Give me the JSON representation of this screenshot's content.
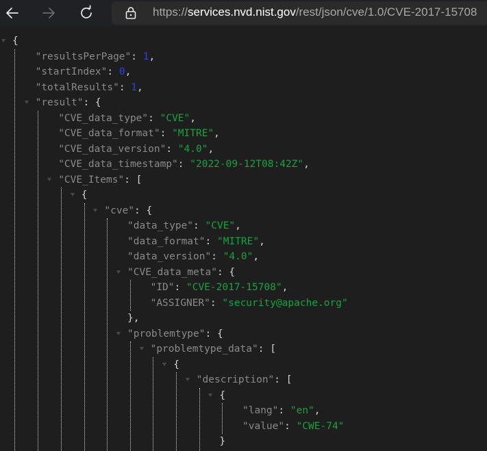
{
  "browser": {
    "url_scheme": "https://",
    "url_host": "services.nvd.nist.gov",
    "url_path": "/rest/json/cve/1.0/CVE-2017-15708"
  },
  "json_view": {
    "colors": {
      "key": "#8a8a8a",
      "punctuation": "#d4d4d4",
      "string": "#17a33e",
      "number": "#2d3ef5",
      "background": "#1e1e1e"
    },
    "lines": [
      {
        "parts": [
          {
            "t": "p",
            "v": "{"
          }
        ],
        "collapsible": true
      },
      {
        "parts": [
          {
            "t": "k",
            "v": "\"resultsPerPage\""
          },
          {
            "t": "p",
            "v": ": "
          },
          {
            "t": "n",
            "v": "1"
          },
          {
            "t": "p",
            "v": ","
          }
        ]
      },
      {
        "parts": [
          {
            "t": "k",
            "v": "\"startIndex\""
          },
          {
            "t": "p",
            "v": ": "
          },
          {
            "t": "n",
            "v": "0"
          },
          {
            "t": "p",
            "v": ","
          }
        ]
      },
      {
        "parts": [
          {
            "t": "k",
            "v": "\"totalResults\""
          },
          {
            "t": "p",
            "v": ": "
          },
          {
            "t": "n",
            "v": "1"
          },
          {
            "t": "p",
            "v": ","
          }
        ]
      },
      {
        "parts": [
          {
            "t": "k",
            "v": "\"result\""
          },
          {
            "t": "p",
            "v": ": {"
          }
        ],
        "collapsible": true
      },
      {
        "parts": [
          {
            "t": "k",
            "v": "\"CVE_data_type\""
          },
          {
            "t": "p",
            "v": ": "
          },
          {
            "t": "s",
            "v": "\"CVE\""
          },
          {
            "t": "p",
            "v": ","
          }
        ]
      },
      {
        "parts": [
          {
            "t": "k",
            "v": "\"CVE_data_format\""
          },
          {
            "t": "p",
            "v": ": "
          },
          {
            "t": "s",
            "v": "\"MITRE\""
          },
          {
            "t": "p",
            "v": ","
          }
        ]
      },
      {
        "parts": [
          {
            "t": "k",
            "v": "\"CVE_data_version\""
          },
          {
            "t": "p",
            "v": ": "
          },
          {
            "t": "s",
            "v": "\"4.0\""
          },
          {
            "t": "p",
            "v": ","
          }
        ]
      },
      {
        "parts": [
          {
            "t": "k",
            "v": "\"CVE_data_timestamp\""
          },
          {
            "t": "p",
            "v": ": "
          },
          {
            "t": "s",
            "v": "\"2022-09-12T08:42Z\""
          },
          {
            "t": "p",
            "v": ","
          }
        ]
      },
      {
        "parts": [
          {
            "t": "k",
            "v": "\"CVE_Items\""
          },
          {
            "t": "p",
            "v": ": ["
          }
        ],
        "collapsible": true
      },
      {
        "parts": [
          {
            "t": "p",
            "v": "{"
          }
        ],
        "collapsible": true
      },
      {
        "parts": [
          {
            "t": "k",
            "v": "\"cve\""
          },
          {
            "t": "p",
            "v": ": {"
          }
        ],
        "collapsible": true
      },
      {
        "parts": [
          {
            "t": "k",
            "v": "\"data_type\""
          },
          {
            "t": "p",
            "v": ": "
          },
          {
            "t": "s",
            "v": "\"CVE\""
          },
          {
            "t": "p",
            "v": ","
          }
        ]
      },
      {
        "parts": [
          {
            "t": "k",
            "v": "\"data_format\""
          },
          {
            "t": "p",
            "v": ": "
          },
          {
            "t": "s",
            "v": "\"MITRE\""
          },
          {
            "t": "p",
            "v": ","
          }
        ]
      },
      {
        "parts": [
          {
            "t": "k",
            "v": "\"data_version\""
          },
          {
            "t": "p",
            "v": ": "
          },
          {
            "t": "s",
            "v": "\"4.0\""
          },
          {
            "t": "p",
            "v": ","
          }
        ]
      },
      {
        "parts": [
          {
            "t": "k",
            "v": "\"CVE_data_meta\""
          },
          {
            "t": "p",
            "v": ": {"
          }
        ],
        "collapsible": true
      },
      {
        "parts": [
          {
            "t": "k",
            "v": "\"ID\""
          },
          {
            "t": "p",
            "v": ": "
          },
          {
            "t": "s",
            "v": "\"CVE-2017-15708\""
          },
          {
            "t": "p",
            "v": ","
          }
        ]
      },
      {
        "parts": [
          {
            "t": "k",
            "v": "\"ASSIGNER\""
          },
          {
            "t": "p",
            "v": ": "
          },
          {
            "t": "s",
            "v": "\"security@apache.org\""
          }
        ]
      },
      {
        "parts": [
          {
            "t": "p",
            "v": "},"
          }
        ]
      },
      {
        "parts": [
          {
            "t": "k",
            "v": "\"problemtype\""
          },
          {
            "t": "p",
            "v": ": {"
          }
        ],
        "collapsible": true
      },
      {
        "parts": [
          {
            "t": "k",
            "v": "\"problemtype_data\""
          },
          {
            "t": "p",
            "v": ": ["
          }
        ],
        "collapsible": true
      },
      {
        "parts": [
          {
            "t": "p",
            "v": "{"
          }
        ],
        "collapsible": true
      },
      {
        "parts": [
          {
            "t": "k",
            "v": "\"description\""
          },
          {
            "t": "p",
            "v": ": ["
          }
        ],
        "collapsible": true
      },
      {
        "parts": [
          {
            "t": "p",
            "v": "{"
          }
        ],
        "collapsible": true
      },
      {
        "parts": [
          {
            "t": "k",
            "v": "\"lang\""
          },
          {
            "t": "p",
            "v": ": "
          },
          {
            "t": "s",
            "v": "\"en\""
          },
          {
            "t": "p",
            "v": ","
          }
        ]
      },
      {
        "parts": [
          {
            "t": "k",
            "v": "\"value\""
          },
          {
            "t": "p",
            "v": ": "
          },
          {
            "t": "s",
            "v": "\"CWE-74\""
          }
        ]
      },
      {
        "parts": [
          {
            "t": "p",
            "v": "}"
          }
        ]
      }
    ]
  }
}
